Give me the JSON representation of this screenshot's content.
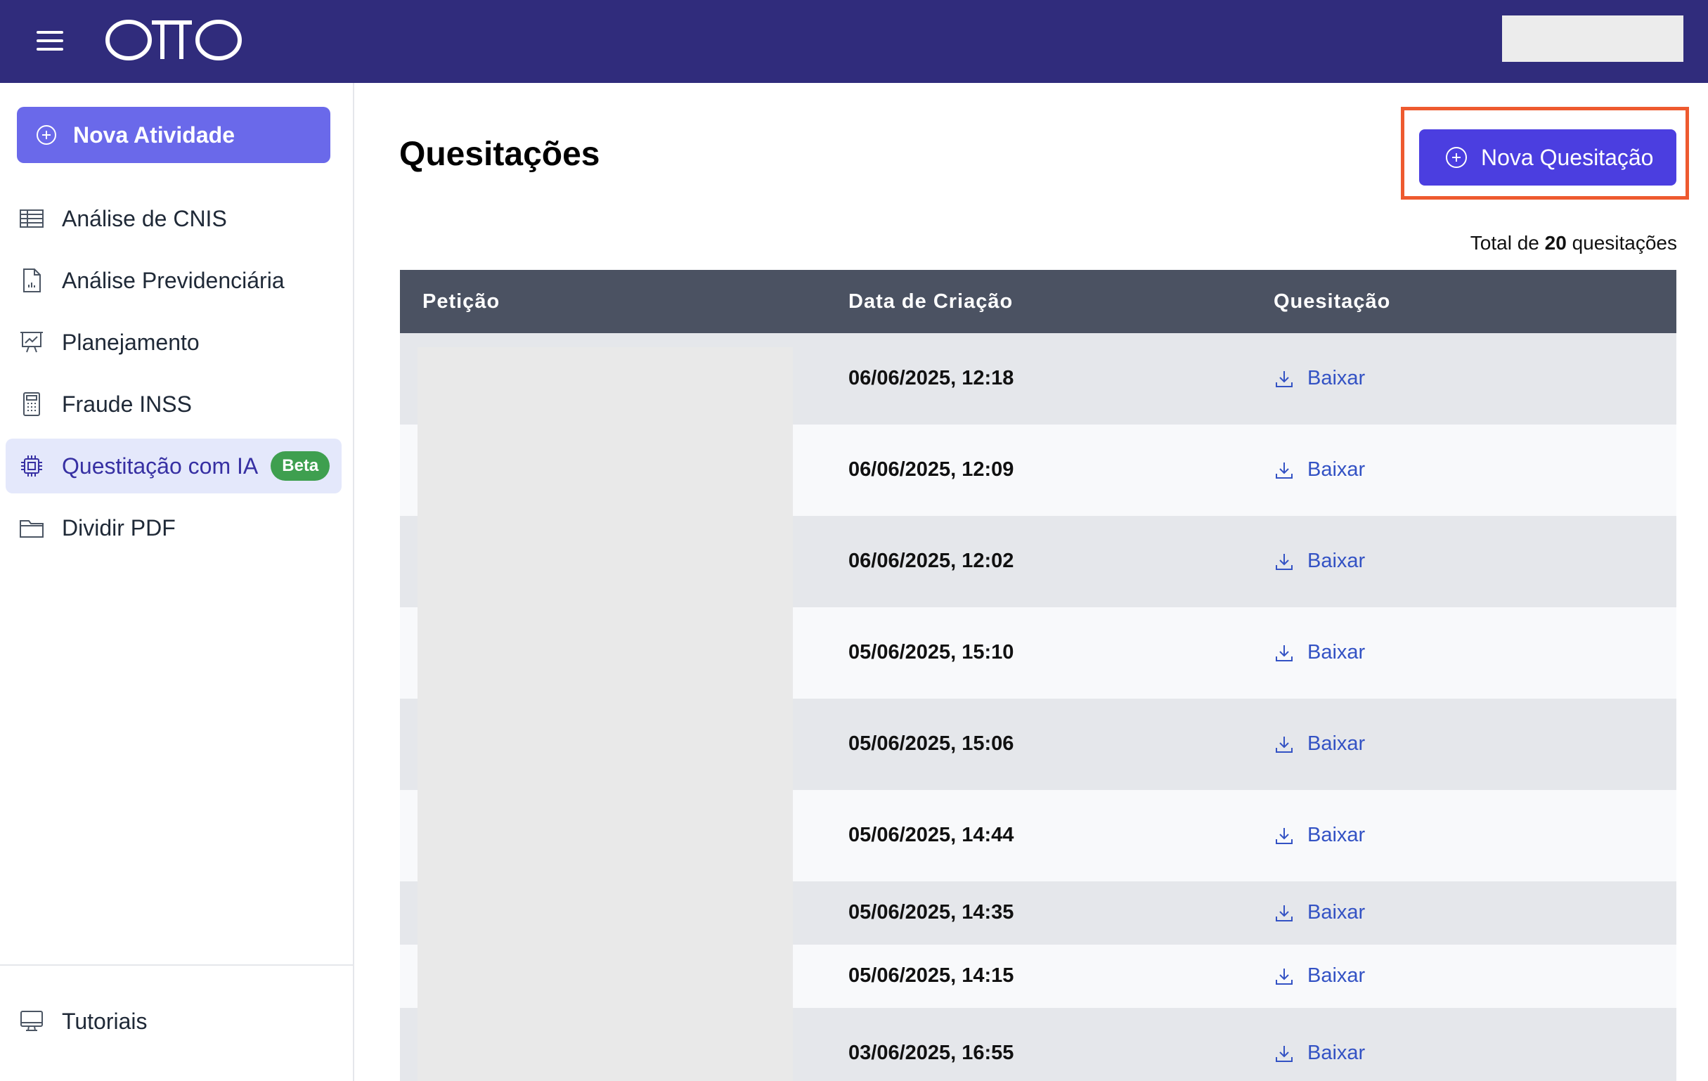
{
  "sidebar": {
    "new_activity_label": "Nova Atividade",
    "items": [
      {
        "label": "Análise de CNIS",
        "icon": "table-icon"
      },
      {
        "label": "Análise Previdenciária",
        "icon": "document-chart-icon"
      },
      {
        "label": "Planejamento",
        "icon": "presentation-chart-icon"
      },
      {
        "label": "Fraude INSS",
        "icon": "calculator-icon"
      },
      {
        "label": "Questitação com IA",
        "icon": "cpu-chip-icon",
        "badge": "Beta"
      },
      {
        "label": "Dividir PDF",
        "icon": "folder-icon"
      }
    ],
    "footer_items": [
      {
        "label": "Tutoriais",
        "icon": "computer-desktop-icon"
      }
    ]
  },
  "main": {
    "title": "Quesitações",
    "new_button_label": "Nova Quesitação",
    "total_prefix": "Total de",
    "total_count": "20",
    "total_suffix": "quesitações"
  },
  "table": {
    "headers": [
      "Petição",
      "Data de Criação",
      "Quesitação"
    ],
    "download_label": "Baixar",
    "rows": [
      {
        "date": "06/06/2025, 12:18"
      },
      {
        "date": "06/06/2025, 12:09"
      },
      {
        "date": "06/06/2025, 12:02"
      },
      {
        "date": "05/06/2025, 15:10"
      },
      {
        "date": "05/06/2025, 15:06"
      },
      {
        "date": "05/06/2025, 14:44"
      },
      {
        "date": "05/06/2025, 14:35"
      },
      {
        "date": "05/06/2025, 14:15"
      },
      {
        "date": "03/06/2025, 16:55"
      }
    ]
  },
  "colors": {
    "topbar": "#302c7c",
    "primary_button": "#4b3ee0",
    "highlight_border": "#ee5a2f",
    "beta_badge": "#3e9f4f",
    "link": "#3352c4"
  }
}
